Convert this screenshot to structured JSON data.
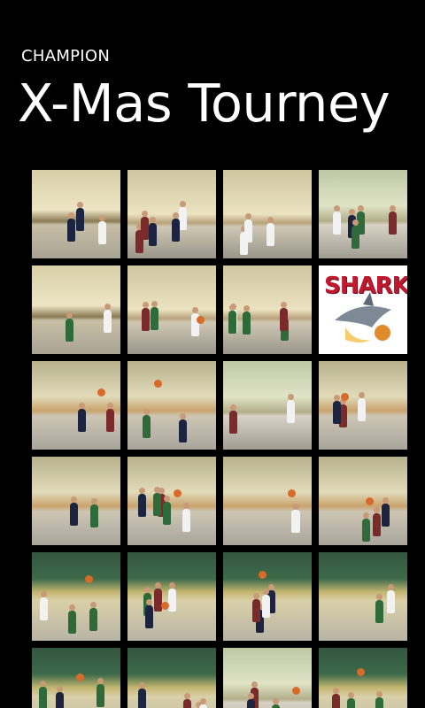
{
  "header": {
    "app_title": "CHAMPION",
    "page_title": "X-Mas Tourney"
  },
  "logo": {
    "text": "SHARK"
  },
  "grid": {
    "columns": 4,
    "thumbnails": [
      {
        "kind": "photo",
        "style": "gym-a"
      },
      {
        "kind": "photo",
        "style": "gym-b"
      },
      {
        "kind": "photo",
        "style": "gym-b"
      },
      {
        "kind": "photo",
        "style": "gym-c"
      },
      {
        "kind": "photo",
        "style": "gym-a"
      },
      {
        "kind": "photo",
        "style": "gym-b"
      },
      {
        "kind": "photo",
        "style": "gym-b"
      },
      {
        "kind": "logo",
        "style": "shark"
      },
      {
        "kind": "photo",
        "style": "gym-e"
      },
      {
        "kind": "photo",
        "style": "gym-e"
      },
      {
        "kind": "photo",
        "style": "gym-c"
      },
      {
        "kind": "photo",
        "style": "gym-e"
      },
      {
        "kind": "photo",
        "style": "gym-e"
      },
      {
        "kind": "photo",
        "style": "gym-e"
      },
      {
        "kind": "photo",
        "style": "gym-e"
      },
      {
        "kind": "photo",
        "style": "gym-e"
      },
      {
        "kind": "photo",
        "style": "gym-d"
      },
      {
        "kind": "photo",
        "style": "gym-d"
      },
      {
        "kind": "photo",
        "style": "gym-d"
      },
      {
        "kind": "photo",
        "style": "gym-d"
      },
      {
        "kind": "photo",
        "style": "gym-d"
      },
      {
        "kind": "photo",
        "style": "gym-d"
      },
      {
        "kind": "photo",
        "style": "gym-c"
      },
      {
        "kind": "photo",
        "style": "gym-d"
      }
    ]
  },
  "colors": {
    "background": "#000000",
    "text": "#ffffff",
    "shark_red": "#c0182f",
    "jersey_navy": "#1c2440",
    "jersey_green": "#2f6b3a"
  }
}
